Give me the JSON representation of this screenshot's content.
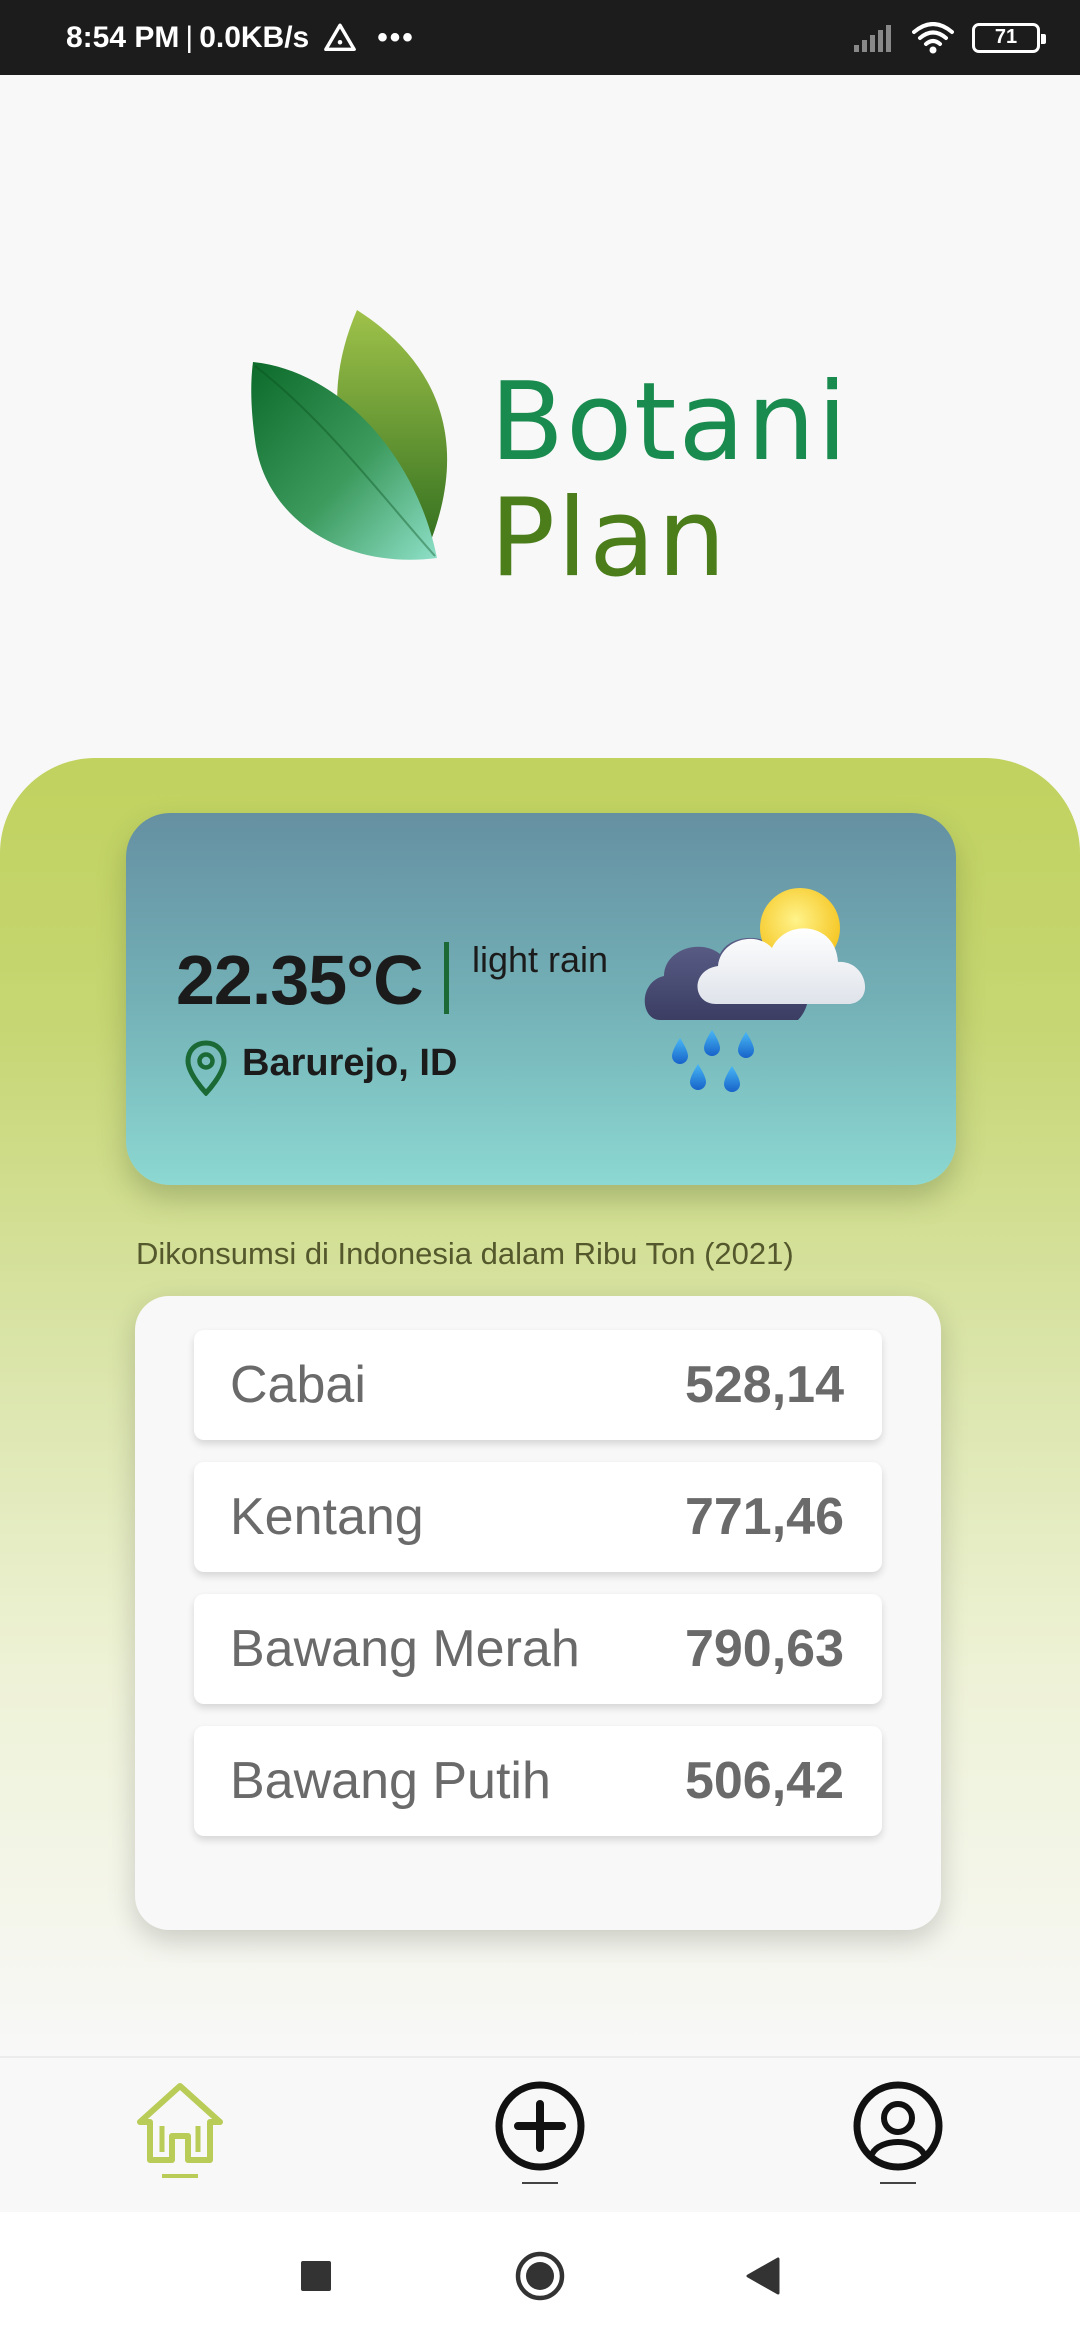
{
  "status_bar": {
    "time": "8:54 PM",
    "separator": "|",
    "net_speed": "0.0KB/s",
    "battery": "71",
    "icons": [
      "alert-icon",
      "more-dots-icon",
      "signal-icon",
      "wifi-icon",
      "battery-icon"
    ]
  },
  "app": {
    "logo_word1": "Botani",
    "logo_word2": "Plan"
  },
  "weather": {
    "temperature": "22.35°C",
    "condition": "light rain",
    "location": "Barurejo, ID",
    "icon": "rain-sun-cloud-icon"
  },
  "consumption": {
    "caption": "Dikonsumsi di Indonesia dalam Ribu Ton (2021)",
    "items": [
      {
        "name": "Cabai",
        "value": "528,14"
      },
      {
        "name": "Kentang",
        "value": "771,46"
      },
      {
        "name": "Bawang Merah",
        "value": "790,63"
      },
      {
        "name": "Bawang Putih",
        "value": "506,42"
      }
    ]
  },
  "bottom_nav": {
    "active": "home",
    "items": [
      "home-icon",
      "add-icon",
      "profile-icon"
    ]
  },
  "colors": {
    "accent": "#b9cc57",
    "brand_green": "#1a8b4f",
    "brand_olive": "#4b7d1b",
    "dark": "#1b1b1b"
  }
}
